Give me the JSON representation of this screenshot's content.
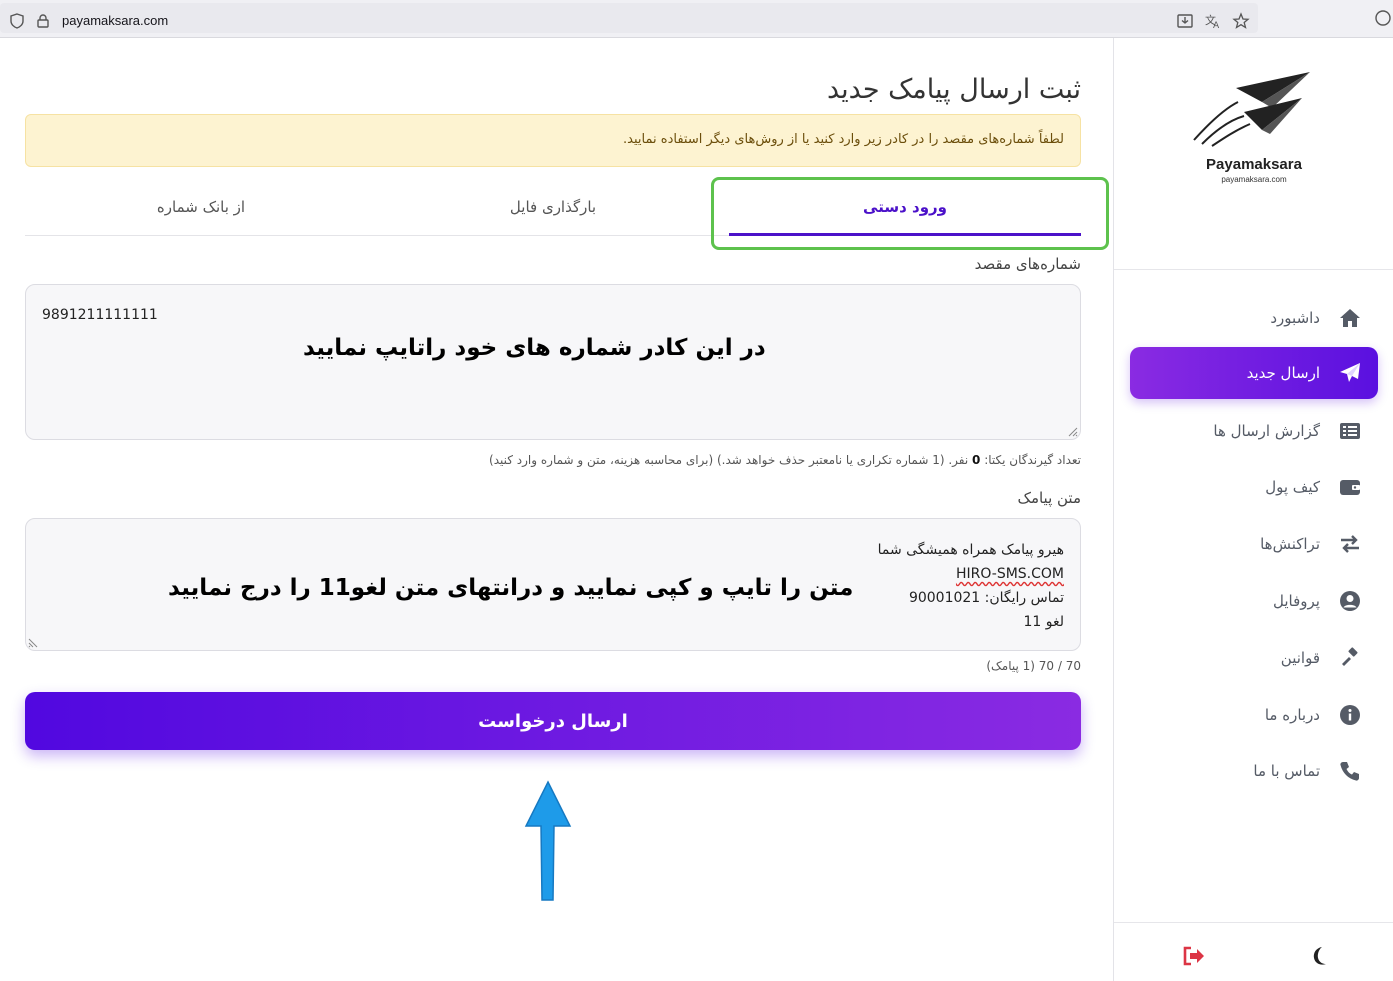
{
  "browser": {
    "url": "payamaksara.com"
  },
  "sidebar": {
    "logo_title": "Payamaksara",
    "logo_subtitle": "payamaksara.com",
    "items": [
      {
        "label": "داشبورد",
        "icon": "home-icon"
      },
      {
        "label": "ارسال جدید",
        "icon": "paper-plane-icon",
        "active": true
      },
      {
        "label": "گزارش ارسال ها",
        "icon": "list-icon"
      },
      {
        "label": "کیف پول",
        "icon": "wallet-icon"
      },
      {
        "label": "تراکنش‌ها",
        "icon": "exchange-icon"
      },
      {
        "label": "پروفایل",
        "icon": "user-circle-icon"
      },
      {
        "label": "قوانین",
        "icon": "gavel-icon"
      },
      {
        "label": "درباره ما",
        "icon": "info-icon"
      },
      {
        "label": "تماس با ما",
        "icon": "phone-icon"
      }
    ]
  },
  "main": {
    "title": "ثبت ارسال پیامک جدید",
    "alert": "لطفاً شماره‌های مقصد را در کادر زیر وارد کنید یا از روش‌های دیگر استفاده نمایید.",
    "tabs": [
      {
        "label": "ورود دستی",
        "active": true
      },
      {
        "label": "بارگذاری فایل"
      },
      {
        "label": "از بانک شماره"
      }
    ],
    "numbers_label": "شماره‌های مقصد",
    "numbers_value": "9891211111111",
    "numbers_overlay": "در این کادر شماره های خود راتایپ نمایید",
    "recipients_hint_prefix": "تعداد گیرندگان یکتا:",
    "recipients_count": "0",
    "recipients_hint_suffix": "نفر. (1 شماره تکراری یا نامعتبر حذف خواهد شد.) (برای محاسبه هزینه، متن و شماره وارد کنید)",
    "message_label": "متن پیامک",
    "message_lines": [
      "هیرو پیامک همراه همیشگی شما",
      "HIRO-SMS.COM",
      "تماس رایگان: 90001021",
      "لغو 11"
    ],
    "message_overlay": "متن را تایپ و کپی نمایید و درانتهای متن لغو11  را درج نمایید",
    "char_count": "70 / 70 (1 پیامک)",
    "submit_label": "ارسال درخواست"
  },
  "colors": {
    "accent": "#5108e0",
    "accent_end": "#8a2be2",
    "alert_bg": "#fdf3d1",
    "highlight": "#5dc24d",
    "arrow": "#1e9be9",
    "logout": "#dc3545"
  }
}
